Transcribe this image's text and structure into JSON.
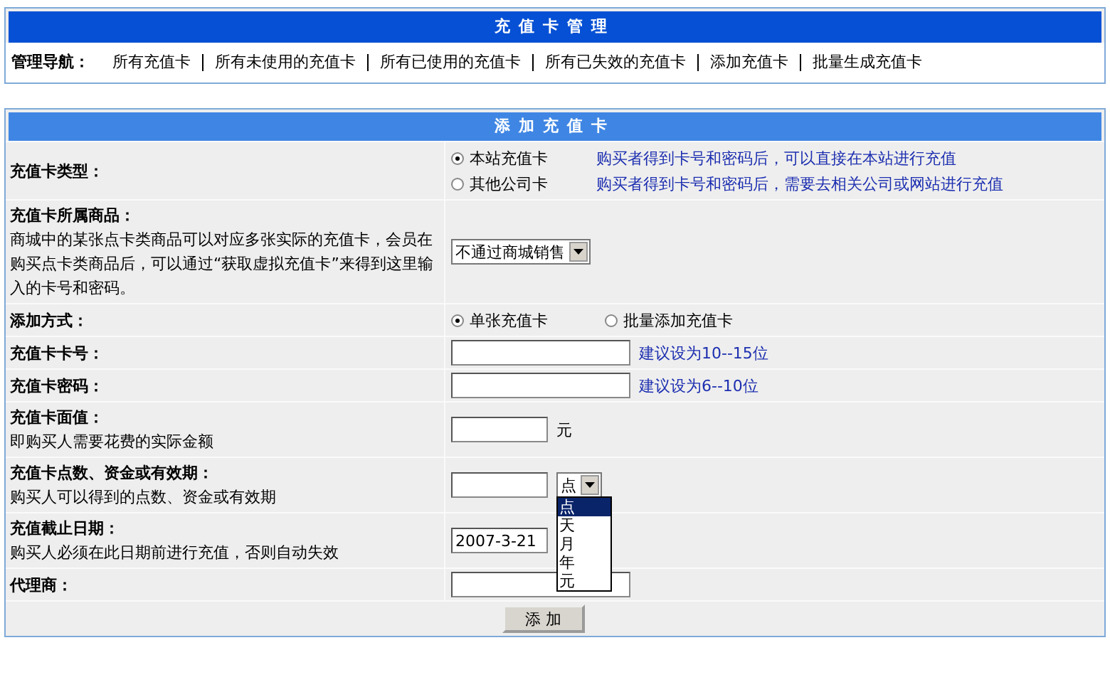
{
  "header": {
    "title": "充值卡管理"
  },
  "nav": {
    "label": "管理导航：",
    "links": [
      "所有充值卡",
      "所有未使用的充值卡",
      "所有已使用的充值卡",
      "所有已失效的充值卡",
      "添加充值卡",
      "批量生成充值卡"
    ]
  },
  "form": {
    "title": "添加充值卡",
    "rows": [
      {
        "kind": "radio-stack",
        "label": "充值卡类型：",
        "options": [
          {
            "label": "本站充值卡",
            "note": "购买者得到卡号和密码后，可以直接在本站进行充值",
            "selected": true
          },
          {
            "label": "其他公司卡",
            "note": "购买者得到卡号和密码后，需要去相关公司或网站进行充值",
            "selected": false
          }
        ]
      },
      {
        "kind": "fields",
        "label": "充值卡所属商品：",
        "hint": "商城中的某张点卡类商品可以对应多张实际的充值卡，会员在购买点卡类商品后，可以通过“获取虚拟充值卡”来得到这里输入的卡号和密码。",
        "controls": [
          {
            "kind": "select",
            "value": "不通过商城销售",
            "open": false
          }
        ]
      },
      {
        "kind": "radio-inline",
        "label": "添加方式：",
        "options": [
          {
            "label": "单张充值卡",
            "selected": true
          },
          {
            "label": "批量添加充值卡",
            "selected": false
          }
        ]
      },
      {
        "kind": "fields",
        "label": "充值卡卡号：",
        "controls": [
          {
            "kind": "wide-input"
          },
          {
            "kind": "note",
            "text": "建议设为10--15位"
          }
        ]
      },
      {
        "kind": "fields",
        "label": "充值卡密码：",
        "controls": [
          {
            "kind": "wide-input"
          },
          {
            "kind": "note",
            "text": "建议设为6--10位"
          }
        ]
      },
      {
        "kind": "fields",
        "label": "充值卡面值：",
        "hint": "即购买人需要花费的实际金额",
        "controls": [
          {
            "kind": "narrow-input"
          },
          {
            "kind": "unit",
            "text": "元"
          }
        ]
      },
      {
        "kind": "fields",
        "label": "充值卡点数、资金或有效期：",
        "hint": "购买人可以得到的点数、资金或有效期",
        "controls": [
          {
            "kind": "narrow-input"
          },
          {
            "kind": "select",
            "value": "点",
            "open": true,
            "options": [
              {
                "label": "点",
                "selected": true
              },
              {
                "label": "天",
                "selected": false
              },
              {
                "label": "月",
                "selected": false
              },
              {
                "label": "年",
                "selected": false
              },
              {
                "label": "元",
                "selected": false
              }
            ]
          }
        ]
      },
      {
        "kind": "fields",
        "label": "充值截止日期：",
        "hint": "购买人必须在此日期前进行充值，否则自动失效",
        "controls": [
          {
            "kind": "narrow-input",
            "value": "2007-3-21"
          }
        ]
      },
      {
        "kind": "fields",
        "label": "代理商：",
        "controls": [
          {
            "kind": "wide-input"
          }
        ]
      }
    ],
    "submit": "添 加"
  }
}
